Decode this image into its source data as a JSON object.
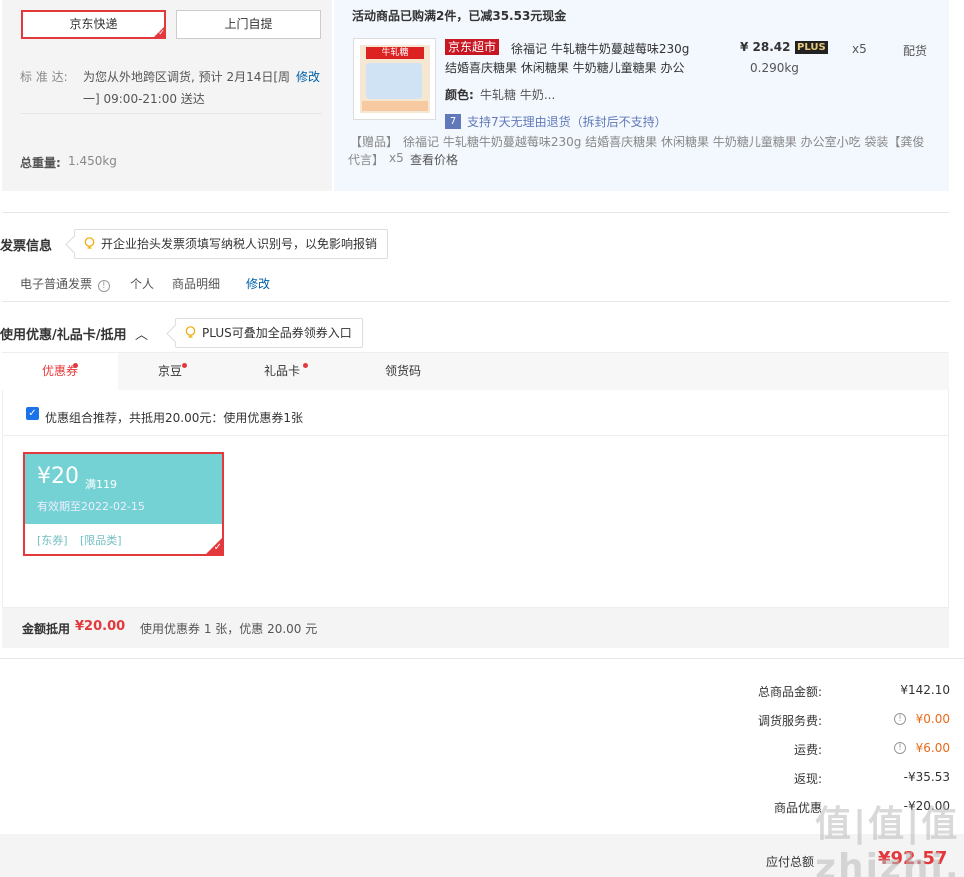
{
  "shipping": {
    "options": [
      "京东快递",
      "上门自提"
    ],
    "standard_label": "标 准 达:",
    "standard_text_1": "为您从外地跨区调货, 预计 2月14日[周",
    "standard_text_2": "一] 09:00-21:00 送达",
    "modify": "修改",
    "weight_label": "总重量:",
    "weight_value": "1.450kg"
  },
  "promo": {
    "headline": "活动商品已购满2件，已减35.53元现金",
    "product": {
      "image_text": "牛轧糖",
      "badge": "京东超市",
      "title_line1": "徐福记 牛轧糖牛奶蔓越莓味230g",
      "title_line2": "结婚喜庆糖果 休闲糖果 牛奶糖儿童糖果 办公",
      "price": "¥ 28.42",
      "plus": "PLUS",
      "qty": "x5",
      "stock": "配货",
      "weight": "0.290kg",
      "color_label": "颜色:",
      "color_value": "牛轧糖 牛奶...",
      "return_badge": "7",
      "return_text": "支持7天无理由退货（拆封后不支持）",
      "gift_label": "【赠品】",
      "gift_text_1": "徐福记 牛轧糖牛奶蔓越莓味230g 结婚喜庆糖果 休闲糖果 牛奶糖儿童糖果 办公室小吃 袋装【龚俊",
      "gift_text_2": "代言】",
      "gift_qty": "x5",
      "gift_price": "查看价格"
    }
  },
  "invoice": {
    "title": "发票信息",
    "tip": "开企业抬头发票须填写纳税人识别号，以免影响报销",
    "type": "电子普通发票",
    "person": "个人",
    "detail": "商品明细",
    "modify": "修改"
  },
  "coupon_section": {
    "title": "使用优惠/礼品卡/抵用",
    "tip": "PLUS可叠加全品券领券入口",
    "tabs": [
      "优惠券",
      "京豆",
      "礼品卡",
      "领货码"
    ],
    "recommend": "优惠组合推荐，共抵用20.00元：使用优惠券1张",
    "coupon": {
      "amount": "¥20",
      "condition": "满119",
      "valid": "有效期至2022-02-15",
      "tag1": "[东券]",
      "tag2": "[限品类]"
    },
    "summary_label": "金额抵用",
    "summary_value": "¥20.00",
    "summary_text": "使用优惠券 1 张，优惠 20.00 元"
  },
  "totals": {
    "rows": [
      {
        "label": "总商品金额:",
        "value": "¥142.10"
      },
      {
        "label": "调货服务费:",
        "value": "¥0.00"
      },
      {
        "label": "运费:",
        "value": "¥6.00"
      },
      {
        "label": "返现:",
        "value": "-¥35.53"
      },
      {
        "label": "商品优惠",
        "value": "-¥20.00"
      }
    ],
    "payable_label": "应付总额",
    "payable_value": "¥92.57"
  },
  "watermark": "值|值|值 zhizhi..."
}
